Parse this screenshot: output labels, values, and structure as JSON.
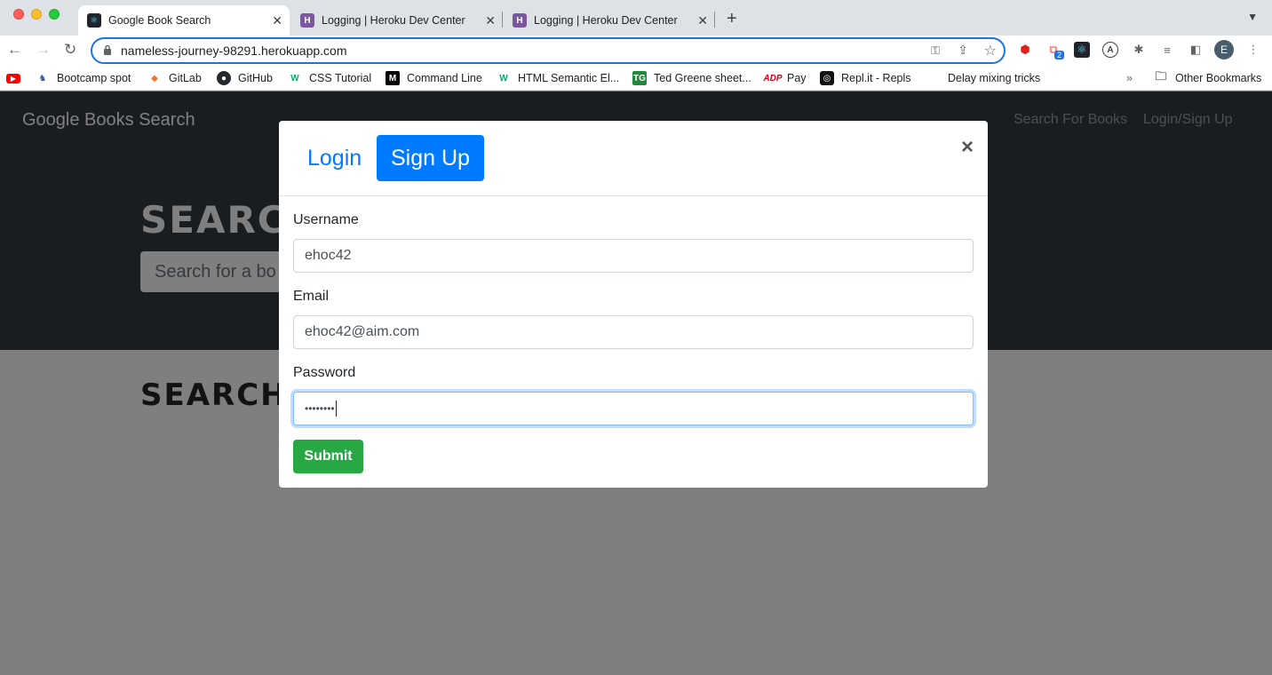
{
  "browser": {
    "tabs": [
      {
        "title": "Google Book Search"
      },
      {
        "title": "Logging | Heroku Dev Center"
      },
      {
        "title": "Logging | Heroku Dev Center"
      }
    ],
    "url": "nameless-journey-98291.herokuapp.com",
    "profile_initial": "E",
    "extension_badge": "2",
    "bookmarks": [
      {
        "label": "Bootcamp spot"
      },
      {
        "label": "GitLab"
      },
      {
        "label": "GitHub"
      },
      {
        "label": "CSS Tutorial"
      },
      {
        "label": "Command Line"
      },
      {
        "label": "HTML Semantic El..."
      },
      {
        "label": "Ted Greene sheet..."
      },
      {
        "label": "Pay"
      },
      {
        "label": "Repl.it - Repls"
      },
      {
        "label": "Delay mixing tricks"
      }
    ],
    "other_bookmarks": "Other Bookmarks"
  },
  "page": {
    "brand": "Google Books Search",
    "nav_links": [
      "Search For Books",
      "Login/Sign Up"
    ],
    "hero_title": "SEARC",
    "search_placeholder": "Search for a bo",
    "results_title": "SEARCH"
  },
  "modal": {
    "tabs": {
      "login": "Login",
      "signup": "Sign Up"
    },
    "active_tab": "signup",
    "close": "×",
    "fields": {
      "username": {
        "label": "Username",
        "value": "ehoc42"
      },
      "email": {
        "label": "Email",
        "value": "ehoc42@aim.com"
      },
      "password": {
        "label": "Password",
        "value": "••••••••"
      }
    },
    "submit": "Submit"
  },
  "colors": {
    "primary": "#007bff",
    "success": "#28a745",
    "navbar": "#343a40"
  }
}
